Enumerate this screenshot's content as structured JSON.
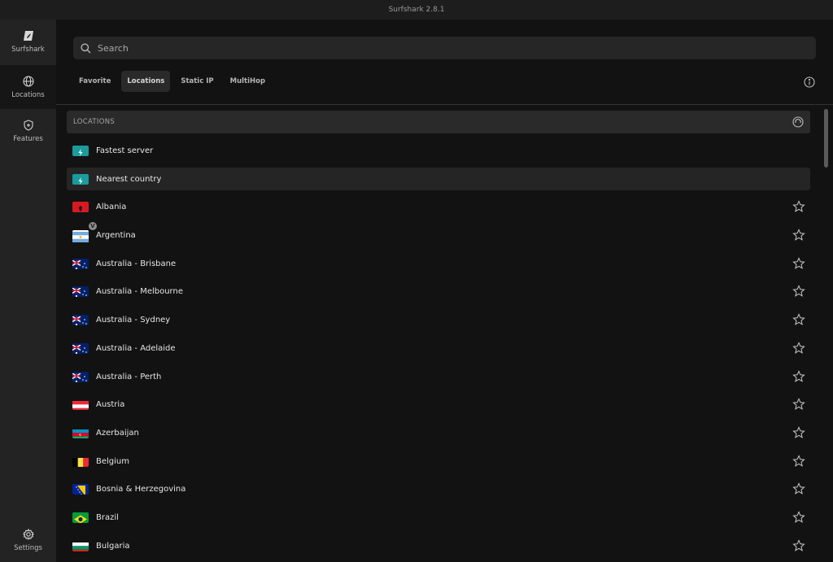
{
  "window": {
    "title": "Surfshark 2.8.1"
  },
  "sidebar": {
    "items": [
      {
        "label": "Surfshark",
        "icon": "surfshark-logo-icon"
      },
      {
        "label": "Locations",
        "icon": "globe-icon"
      },
      {
        "label": "Features",
        "icon": "shield-icon"
      }
    ],
    "settings_label": "Settings"
  },
  "search": {
    "placeholder": "Search",
    "value": ""
  },
  "tabs": [
    {
      "label": "Favorite"
    },
    {
      "label": "Locations"
    },
    {
      "label": "Static IP"
    },
    {
      "label": "MultiHop"
    }
  ],
  "list": {
    "header": "LOCATIONS",
    "quick": [
      {
        "label": "Fastest server"
      },
      {
        "label": "Nearest country"
      }
    ],
    "countries": [
      {
        "label": "Albania"
      },
      {
        "label": "Argentina",
        "badge": "V"
      },
      {
        "label": "Australia - Brisbane"
      },
      {
        "label": "Australia - Melbourne"
      },
      {
        "label": "Australia - Sydney"
      },
      {
        "label": "Australia - Adelaide"
      },
      {
        "label": "Australia - Perth"
      },
      {
        "label": "Austria"
      },
      {
        "label": "Azerbaijan"
      },
      {
        "label": "Belgium"
      },
      {
        "label": "Bosnia & Herzegovina"
      },
      {
        "label": "Brazil"
      },
      {
        "label": "Bulgaria"
      }
    ]
  },
  "colors": {
    "accent": "#1aa3a3",
    "background": "#121212",
    "sidebar": "#232323"
  }
}
